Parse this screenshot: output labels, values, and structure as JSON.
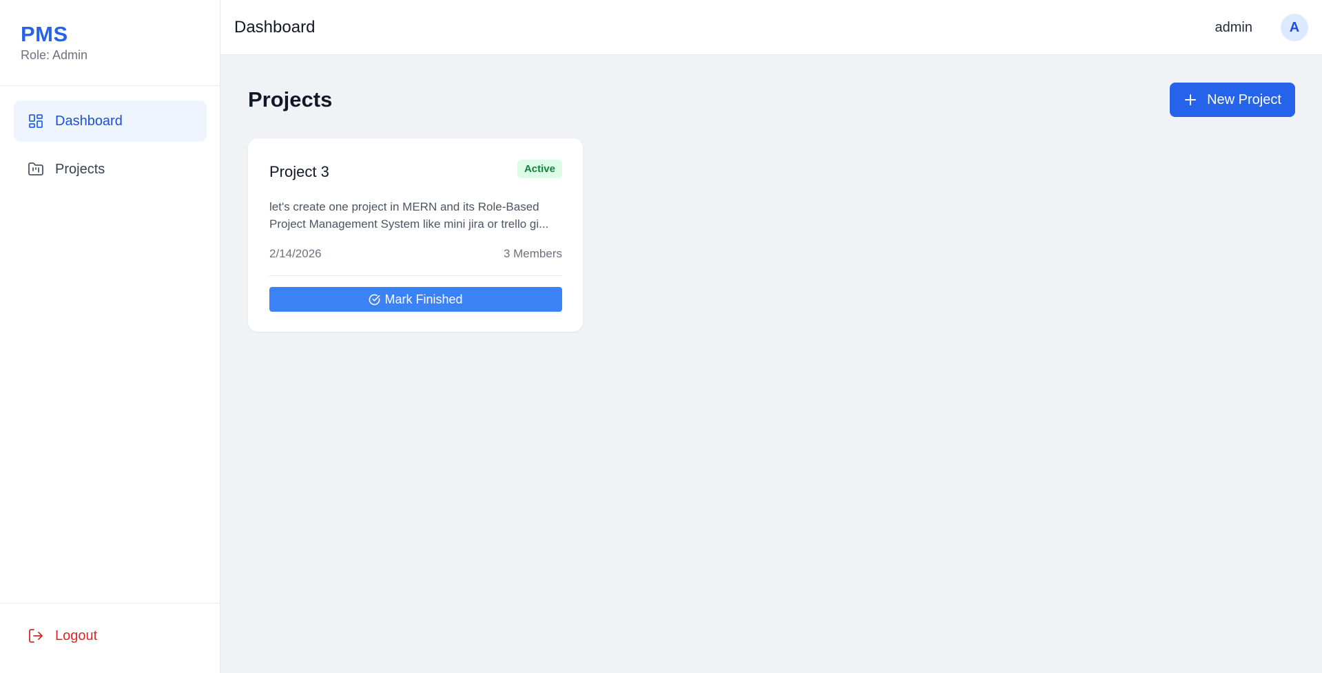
{
  "sidebar": {
    "brand": "PMS",
    "role": "Role: Admin",
    "items": [
      {
        "label": "Dashboard",
        "icon": "dashboard-grid-icon",
        "active": true
      },
      {
        "label": "Projects",
        "icon": "folder-kanban-icon",
        "active": false
      }
    ],
    "logout": {
      "label": "Logout",
      "icon": "logout-icon"
    }
  },
  "header": {
    "title": "Dashboard",
    "user": "admin",
    "avatar_initial": "A"
  },
  "main": {
    "title": "Projects",
    "new_project_label": "New Project",
    "projects": [
      {
        "name": "Project 3",
        "status": "Active",
        "description": "let's create one project in MERN and its Role-Based Project Management System like mini jira or trello gi...",
        "date": "2/14/2026",
        "members": "3 Members",
        "action_label": "Mark Finished"
      }
    ]
  },
  "colors": {
    "accent": "#2563eb",
    "background": "#f1f2f5",
    "status_active_bg": "#dcfce7",
    "status_active_text": "#15803d",
    "logout": "#dc2626"
  }
}
